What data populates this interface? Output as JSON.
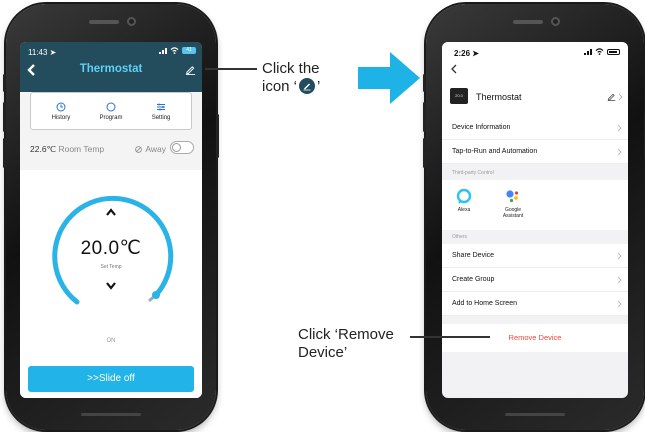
{
  "left_phone": {
    "status_time": "11:43",
    "battery": "41",
    "title": "Thermostat",
    "tabs": [
      {
        "label": "History",
        "icon": "clock-icon"
      },
      {
        "label": "Program",
        "icon": "program-icon"
      },
      {
        "label": "Setting",
        "icon": "sliders-icon"
      }
    ],
    "room_temp_value": "22.6℃",
    "room_temp_label": "Room Temp",
    "away_label": "Away",
    "set_temp_value": "20.0℃",
    "set_temp_label": "Set Temp",
    "state_label": "ON",
    "slide_button": ">>Slide off",
    "colors": {
      "header": "#234c5c",
      "accent": "#22b4e8",
      "title": "#5fd0f5"
    }
  },
  "right_phone": {
    "status_time": "2:26",
    "device_name": "Thermostat",
    "device_icon_text": "20.0",
    "rows_top": [
      "Device Information",
      "Tap-to-Run and Automation"
    ],
    "section_third_party": "Third-party Control",
    "third_party": [
      {
        "name": "Alexa",
        "icon": "alexa-icon"
      },
      {
        "name": "Google Assistant",
        "icon": "google-assistant-icon"
      }
    ],
    "section_others": "Others",
    "rows_others": [
      "Share Device",
      "Create Group",
      "Add to Home Screen"
    ],
    "remove_device": "Remove Device",
    "colors": {
      "remove": "#f0463a"
    }
  },
  "annotations": {
    "click_icon_line1": "Click the",
    "click_icon_prefix": "icon ‘",
    "click_icon_suffix": "’",
    "remove_line1": "Click ‘Remove",
    "remove_line2": "Device’"
  },
  "arrow_color": "#1fb2e6"
}
